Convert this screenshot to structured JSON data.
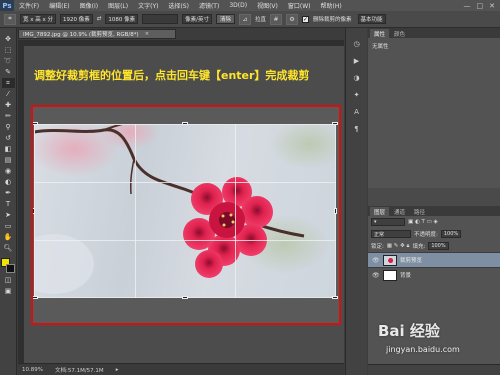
{
  "app": {
    "logo": "Ps",
    "menus": [
      "文件(F)",
      "编辑(E)",
      "图像(I)",
      "图层(L)",
      "文字(Y)",
      "选择(S)",
      "滤镜(T)",
      "3D(D)",
      "视图(V)",
      "窗口(W)",
      "帮助(H)"
    ],
    "window_controls": [
      "—",
      "□",
      "✕"
    ]
  },
  "options_bar": {
    "ratio_select": "宽 x 高 x 分",
    "width_value": "1920 像素",
    "swap_icon": "⇄",
    "height_value": "1080 像素",
    "resolution_value": "",
    "unit_select": "像素/英寸",
    "clear_button": "清除",
    "straighten_label": "拉直",
    "delete_cropped_label": "删除裁剪的像素",
    "delete_cropped_checked": true,
    "workspace_select": "基本功能"
  },
  "document": {
    "tab_title": "IMG_7892.jpg @ 10.9% (裁剪预览, RGB/8*)",
    "tab_close": "×"
  },
  "annotation": {
    "text": "调整好裁剪框的位置后，点击回车键【enter】完成裁剪",
    "color": "#ffe52c"
  },
  "status": {
    "zoom": "10.89%",
    "doc_size": "文档:57.1M/57.1M"
  },
  "panels": {
    "top_tabs": [
      "属性",
      "颜色"
    ],
    "properties_text": "无属性",
    "layer_tabs": [
      "图层",
      "通道",
      "路径"
    ],
    "blend_mode": "正常",
    "opacity_label": "不透明度:",
    "opacity_value": "100%",
    "lock_label": "锁定:",
    "fill_label": "填充:",
    "fill_value": "100%",
    "layers": [
      {
        "name": "裁剪预览",
        "selected": true
      },
      {
        "name": "背景",
        "selected": false
      }
    ]
  },
  "watermark": {
    "brand": "Bai 经验",
    "url": "jingyan.baidu.com"
  },
  "colors": {
    "highlight": "#d80f0f",
    "foreground": "#f2e300",
    "background": "#111111",
    "selected_layer": "#7e8fa3"
  }
}
